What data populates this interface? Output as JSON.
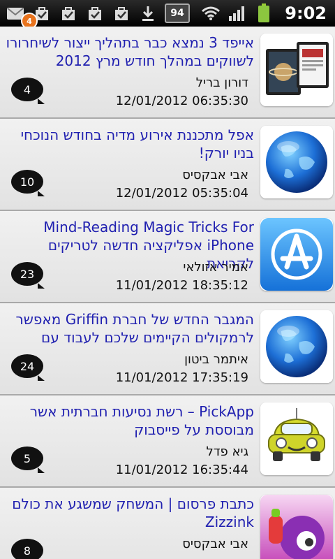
{
  "status_bar": {
    "notification_count": "4",
    "battery_percent": "94",
    "time": "9:02"
  },
  "articles": [
    {
      "title": "אייפד 3 נמצא כבר בתהליך ייצור לשיחרורו לשווקים במהלך חודש מרץ 2012",
      "author": "דורון בריל",
      "date": "12/01/2012 06:35:30",
      "comments": "4",
      "thumb": "ipad-icon"
    },
    {
      "title": "אפל מתכננת אירוע מדיה בחודש הנוכחי בניו יורק!",
      "author": "אבי אבקסיס",
      "date": "12/01/2012 05:35:04",
      "comments": "10",
      "thumb": "globe-icon"
    },
    {
      "title": "Mind-Reading Magic Tricks For iPhone אפליקציה חדשה לטריקים לקריאת",
      "author": "אמיר אזולאי",
      "date": "11/01/2012 18:35:12",
      "comments": "23",
      "thumb": "app-store-icon"
    },
    {
      "title": "המגבר החדש של חברת Griffin מאפשר לרמקולים הקיימים שלכם לעבוד עם",
      "author": "איתמר ביטון",
      "date": "11/01/2012 17:35:19",
      "comments": "24",
      "thumb": "globe-icon"
    },
    {
      "title": "PickApp – רשת נסיעות חברתית אשר מבוססת על פייסבוק",
      "author": "גיא פדל",
      "date": "11/01/2012 16:35:44",
      "comments": "5",
      "thumb": "car-icon"
    },
    {
      "title": "כתבת פרסום | המשחק שמשגע את כולם Zizzink",
      "author": "אבי אבקסיס",
      "date": "",
      "comments": "8",
      "thumb": "game-icon"
    }
  ]
}
